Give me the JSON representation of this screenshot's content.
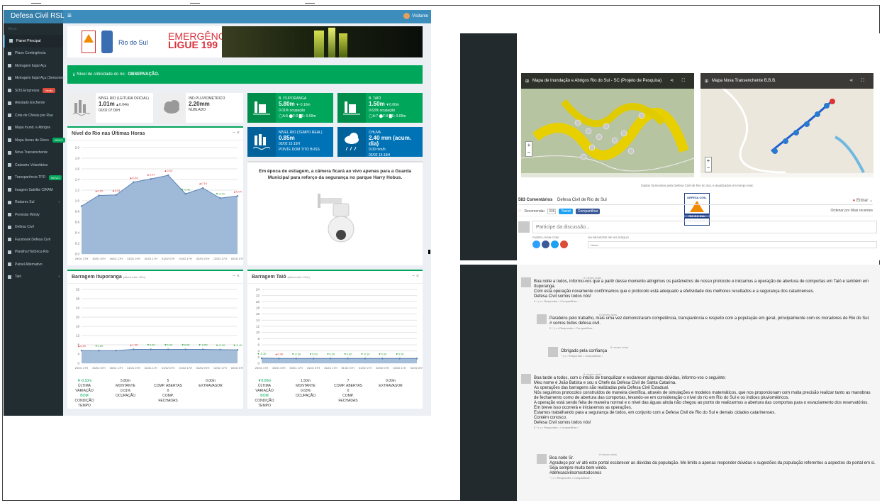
{
  "colors": {
    "green": "#00a65a",
    "blue": "#0073b7",
    "topbar": "#3c8dbc",
    "sidebar": "#222d32",
    "alert_red": "#dd4b39"
  },
  "topbar": {
    "brand": "Defesa Civil RSL",
    "menu_icon": "hamburger-icon",
    "user": "Visitante"
  },
  "sidebar": {
    "header": "Menu",
    "items": [
      {
        "label": "Painel Principal",
        "icon": "dashboard-icon",
        "active": true
      },
      {
        "label": "Plano Contingência",
        "icon": "plan-icon"
      },
      {
        "label": "Metragem Itajaí Açu",
        "icon": "chart-icon"
      },
      {
        "label": "Metragem Itajaí Açu (Sensores)",
        "icon": "chart-icon"
      },
      {
        "label": "SOS Empresas",
        "icon": "briefcase-icon",
        "badge": "Vazão"
      },
      {
        "label": "Atestado Enchente",
        "icon": "document-icon"
      },
      {
        "label": "Cota de Cheias por Rua",
        "icon": "road-icon"
      },
      {
        "label": "Mapa Inund. e Abrigos",
        "icon": "map-icon"
      },
      {
        "label": "Mapa Áreas de Risco",
        "icon": "map-icon",
        "badge": "NOVO"
      },
      {
        "label": "Nova Transenchente",
        "icon": "map-icon"
      },
      {
        "label": "Cadastro Voluntários",
        "icon": "users-icon"
      },
      {
        "label": "Transparência TPD",
        "icon": "eye-icon",
        "badge": "NOVO"
      },
      {
        "label": "Imagem Satélite CIRAM",
        "icon": "image-icon"
      },
      {
        "label": "Radares Sul",
        "icon": "radar-icon",
        "chevron": true
      },
      {
        "label": "Previsão Windy",
        "icon": "wind-icon"
      },
      {
        "label": "Defesa Civil",
        "icon": "shield-icon"
      },
      {
        "label": "Facebook Defesa Civil",
        "icon": "facebook-icon"
      },
      {
        "label": "Planilha Histórica Rio",
        "icon": "table-icon"
      },
      {
        "label": "Painel Alternativo",
        "icon": "dashboard-icon"
      },
      {
        "label": "Taió",
        "icon": "flag-icon",
        "chevron": true
      }
    ]
  },
  "banner": {
    "logo_text": "Rio do Sul",
    "emergency_line1": "EMERGÊNCIA",
    "emergency_line2": "LIGUE 199"
  },
  "alert": {
    "text": "Nível de criticidade do rio:",
    "level": "OBSERVAÇÃO."
  },
  "boxes": {
    "nivel_rio": {
      "title": "NÍVEL RIO (LEITURA OFICIAL)",
      "value": "1.01m",
      "delta": "▲0.04m",
      "time": "02/02 07:00H"
    },
    "pluvio": {
      "title": "IND.PLUVIOMÉTRICO",
      "value": "2.20mm",
      "sub": "NUBLADO"
    },
    "ituporanga": {
      "title": "B. ITUPORANGA",
      "value": "5.80m",
      "delta": "▼-0.10m",
      "occ": "0.01% ocupação",
      "gates": "◯A:5  ⬤F:0  ▇E: 0.00m"
    },
    "taio": {
      "title": "B. TAIÓ",
      "value": "1.50m",
      "delta": "▼0.00m",
      "occ": "0.63% ocupação",
      "gates": "◯A:7  ⬤F:0  ▇E: 0.00m"
    },
    "tempo_real": {
      "title": "NÍVEL RIO (TEMPO REAL)",
      "value": "0.85m",
      "time": "02/02 15:15H",
      "sub": "PONTE DOM TITO BUSS"
    },
    "chuva": {
      "title": "CHUVA",
      "value": "2.40 mm (acum. dia)",
      "sub1": "0.00 mm/h",
      "time": "02/02 15:15H"
    }
  },
  "panels": {
    "nivel_chart_title": "Nível do Rio nas Últimas Horas",
    "camera_text": "Em época de estiagem, a câmera ficará ao vivo apenas para a Guarda Municipal para reforço da segurança no parque Harry Hobus.",
    "itu_title": "Barragem Ituporanga",
    "itu_sub": "(altura máx: 32m)",
    "taio_title": "Barragem Taió",
    "taio_sub": "(altura máx: 22m)",
    "tools": "− ×"
  },
  "itu_stats": [
    {
      "value": "▼-0.10m",
      "label": "ÚLTIMA VARIAÇÃO",
      "extra": "BOM",
      "extra_label": "CONDIÇÃO TEMPO"
    },
    {
      "value": "5.80m",
      "label": "MONTANTE",
      "extra": "0.01%",
      "extra_label": "OCUPAÇÃO"
    },
    {
      "value": "5",
      "label": "COMP. ABERTAS",
      "extra": "0",
      "extra_label": "COMP. FECHADAS"
    },
    {
      "value": "0.00m",
      "label": "EXTRAVASOR",
      "extra": "",
      "extra_label": ""
    }
  ],
  "taio_stats": [
    {
      "value": "▼0.00m",
      "label": "ÚLTIMA VARIAÇÃO",
      "extra": "BOM",
      "extra_label": "CONDIÇÃO TEMPO"
    },
    {
      "value": "1.50m",
      "label": "MONTANTE",
      "extra": "0.63%",
      "extra_label": "OCUPAÇÃO"
    },
    {
      "value": "7",
      "label": "COMP. ABERTAS",
      "extra": "0",
      "extra_label": "COMP. FECHADAS"
    },
    {
      "value": "0.00m",
      "label": "EXTRAVASOR",
      "extra": "",
      "extra_label": ""
    }
  ],
  "chart_data": [
    {
      "type": "area",
      "title": "Nível do Rio nas Últimas Horas",
      "x": [
        "29/01 17H",
        "30/01 07H",
        "30/01 17H",
        "31/01 07H",
        "31/01 17H",
        "01/02 07H",
        "01/02 17H",
        "02/02 07H",
        "02/02 17H",
        "02/02 07H"
      ],
      "y": [
        0.9,
        1.1,
        1.11,
        1.35,
        1.41,
        1.48,
        1.13,
        1.24,
        1.05,
        1.09
      ],
      "labels": [
        "",
        "▲0.20",
        "▲0.01",
        "▲0.24",
        "▲0.07",
        "▲0.02",
        "▼-0.42",
        "▲0.15",
        "▼-0.21",
        "▲0.04"
      ],
      "ylim": [
        0,
        2.0
      ],
      "yticks": [
        0,
        0.2,
        0.4,
        0.6,
        0.8,
        1.0,
        1.2,
        1.4,
        1.6,
        1.8,
        2.0
      ]
    },
    {
      "type": "area",
      "title": "Barragem Ituporanga",
      "x": [
        "29/01 17H",
        "30/01 07H",
        "30/01 17H",
        "31/01 07H",
        "31/01 17H",
        "01/02 07H",
        "01/02 17H",
        "02/02 07H",
        "02/02 17H",
        "02/02 07H"
      ],
      "y": [
        5.5,
        5.5,
        5.5,
        6.0,
        6.0,
        6.0,
        6.0,
        6.0,
        5.9,
        5.8
      ],
      "labels": [
        "▲0.20",
        "▼0.00",
        "",
        "▲1.00",
        "▼0.00",
        "▼0.00",
        "▼0.00",
        "▼-0.50",
        "▼-0.10",
        "▼-0.10"
      ],
      "ylim": [
        0,
        32
      ],
      "yticks": [
        0,
        4,
        8,
        12,
        16,
        20,
        24,
        28,
        32
      ]
    },
    {
      "type": "area",
      "title": "Barragem Taió",
      "x": [
        "29/01 17H",
        "30/01 07H",
        "30/01 17H",
        "31/01 07H",
        "31/01 17H",
        "01/02 07H",
        "01/02 17H",
        "02/02 07H",
        "02/02 17H",
        "02/02 07H"
      ],
      "y": [
        1.6,
        1.5,
        1.5,
        1.5,
        1.5,
        1.5,
        1.5,
        1.5,
        1.5,
        1.5
      ],
      "labels": [
        "▼-0.30",
        "▲0.40",
        "▼-0.30",
        "▼0.00",
        "▼0.00",
        "▼0.00",
        "▼-0.10",
        "▼0.00",
        "▼0.00",
        ""
      ],
      "ylim": [
        0,
        24
      ],
      "yticks": [
        0,
        2,
        4,
        6,
        8,
        10,
        12,
        14,
        16,
        18,
        20,
        22,
        24
      ]
    }
  ],
  "maps": {
    "left_title": "Mapa de Inundação e Abrigos Rio do Sul - SC (Projeto de Pesquisa)",
    "right_title": "Mapa Nova Transenchente B.B.B.",
    "caption": "Dados fornecidos pela Defesa Civil de Rio do Sul, e atualizados em tempo real.",
    "logo_line1": "DEFESA CIVIL",
    "logo_line2": "RIO DO SUL"
  },
  "disqus": {
    "count": "583 Comentários",
    "site": "Defesa Civil de Rio do Sul",
    "login": "Entrar",
    "recommend": "Recomendar",
    "recommend_count": "336",
    "tweet": "Tweet",
    "share": "Compartilhar",
    "sort": "Ordenar por Mais recentes",
    "placeholder": "Participe da discussão...",
    "login_with": "FAZER LOGIN COM",
    "or_register": "OU REGISTRE-SE NO DISQUS",
    "name_placeholder": "Nome"
  },
  "comments": [
    {
      "time": "8 meses atrás",
      "lines": [
        "Boa noite a todos, informo-vos que a partir desse momento atingimos os parâmetros de nosso protocolo e iniciamos a operação de abertura de comportas em Taió e também em Ituporanga.",
        "Com esta operação novamente confirmamos que o protocolo está adequado a efetividade dos melhores resultados e a segurança dos catarinenses.",
        "Defesa Civil somos todos nós!"
      ],
      "actions": "4 ^ | v • Responder • Compartilhar ›"
    },
    {
      "time": "8 meses atrás",
      "lines": [
        "Parabéns pelo trabalho, mais uma vez demonstraram competência, transparência e respeito com a população em geral, principalmente com os moradores de Rio do Sul.",
        "# somos todos defesa civil."
      ],
      "actions": "2 ^ | v • Responder • Compartilhar ›"
    },
    {
      "time": "8 meses atrás",
      "lines": [
        "Obrigado pela confiança"
      ],
      "actions": "^ | v • Responder • Compartilhar ›"
    },
    {
      "time": "8 meses atrás",
      "lines": [
        "Boa tarde a todos, com o intuito de tranquilizar e esclarecer algumas dúvidas, informo-vos o seguinte:",
        "Meu nome é João Batista e sou o Chefe da Defesa Civil de Santa Catarina.",
        "As operações das barragens são realizadas pela Defesa Civil Estadual.",
        "Nós seguimos protocolos construídos de maneira científica, através de simulações e modelos matemáticos, que nos proporcionam com muita precisão realizar tanto as manobras de fechamento como de abertura das comportas, levando-se em consideração o nível do rio em Rio do Sul e os índices pluviométricos.",
        "A operação está sendo feita de maneira normal e o nível das águas ainda não chegou ao ponto de realizarmos a abertura das comportas para o esvaziamento dos reservatórios.",
        "Em breve isso ocorrerá e iniciaremos as operações.",
        "Estamos trabalhando para a segurança de todos, em conjunto com a Defesa Civil de Rio do Sul e demais cidades catarinenses.",
        "Contém conosco.",
        "Defesa Civil somos todos nós!"
      ],
      "actions": "5 ^ | v • Responder • Compartilhar ›"
    },
    {
      "time": "8 meses atrás",
      "lines": [
        "Boa noite Sr.",
        "Agradeço por vir até este portal esclarecer as dúvidas da população. Me limito a apenas responder dúvidas e sugestões da população referentes a aspectos do portal em si.",
        "Seja sempre muito bem-vindo.",
        "#defesacivilsomostodosnos"
      ],
      "actions": "^ | v • Responder • Compartilhar ›"
    }
  ]
}
